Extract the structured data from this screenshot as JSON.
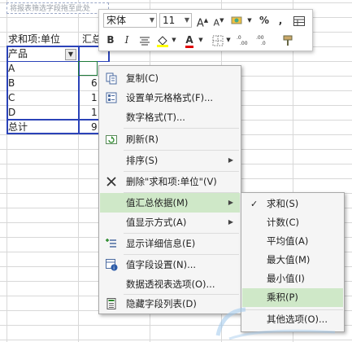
{
  "sheet": {
    "drop_hint": "将报表筛选字段拖至此处",
    "pivot_header": "求和项:单位",
    "pivot_header_col2": "汇总",
    "row_label_header": "产品",
    "filter_glyph": "▼",
    "rows": [
      {
        "label": "A",
        "value": ""
      },
      {
        "label": "B",
        "value": "6"
      },
      {
        "label": "C",
        "value": "1"
      },
      {
        "label": "D",
        "value": "1"
      }
    ],
    "total_label": "总计",
    "total_value": "9"
  },
  "mini_toolbar": {
    "font_name": "宋体",
    "font_size": "11",
    "grow_font": "A",
    "shrink_font": "A",
    "percent": "%",
    "comma": ",",
    "bold": "B",
    "italic": "I",
    "font_color_glyph": "A",
    "highlight_color": "#ffff00",
    "font_color": "#e00000"
  },
  "context_menu": {
    "items": [
      {
        "label": "复制(C)"
      },
      {
        "label": "设置单元格格式(F)..."
      },
      {
        "label": "数字格式(T)..."
      },
      {
        "label": "刷新(R)"
      },
      {
        "label": "排序(S)"
      },
      {
        "label": "删除\"求和项:单位\"(V)"
      },
      {
        "label": "值汇总依据(M)"
      },
      {
        "label": "值显示方式(A)"
      },
      {
        "label": "显示详细信息(E)"
      },
      {
        "label": "值字段设置(N)..."
      },
      {
        "label": "数据透视表选项(O)..."
      },
      {
        "label": "隐藏字段列表(D)"
      }
    ],
    "submenu_arrow": "▶"
  },
  "submenu": {
    "check": "✓",
    "items": [
      {
        "label": "求和(S)"
      },
      {
        "label": "计数(C)"
      },
      {
        "label": "平均值(A)"
      },
      {
        "label": "最大值(M)"
      },
      {
        "label": "最小值(I)"
      },
      {
        "label": "乘积(P)"
      },
      {
        "label": "其他选项(O)..."
      }
    ]
  },
  "colors": {
    "pivot_border": "#2b43b8",
    "menu_highlight": "#cfe8c8",
    "grid": "#d8d8d8"
  }
}
